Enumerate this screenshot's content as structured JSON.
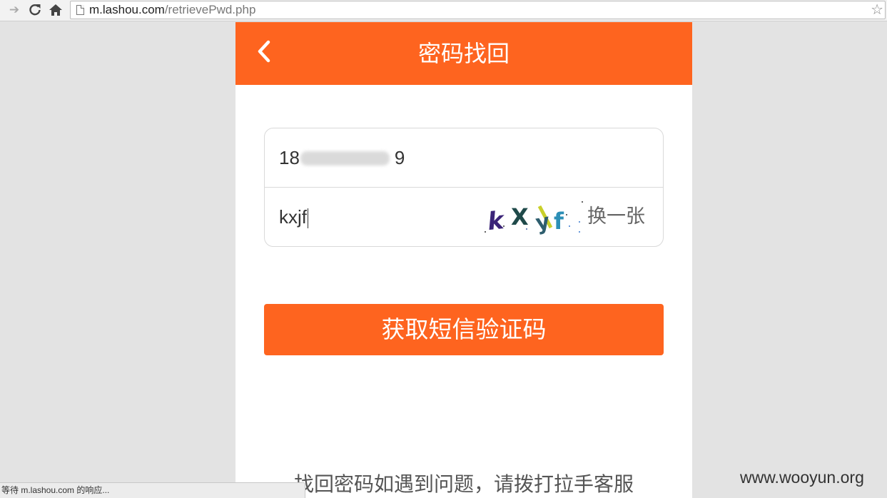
{
  "browser": {
    "back_icon": "arrow-left-icon",
    "reload_icon": "reload-icon",
    "home_icon": "home-icon",
    "url_host": "m.lashou.com",
    "url_path": "/retrievePwd.php",
    "bookmark_icon": "star-icon",
    "status_text": "等待 m.lashou.com 的响应..."
  },
  "header": {
    "back_icon": "chevron-left-icon",
    "title": "密码找回",
    "background": "#fe641f"
  },
  "form": {
    "phone_value_start": "18",
    "phone_value_end": "9",
    "captcha_value": "kxjf",
    "captcha_image_text": "kXyf",
    "refresh_label": "换一张"
  },
  "actions": {
    "sms_button_label": "获取短信验证码"
  },
  "footer": {
    "help_text": "找回密码如遇到问题，请拨打拉手客服"
  },
  "watermark": "www.wooyun.org"
}
